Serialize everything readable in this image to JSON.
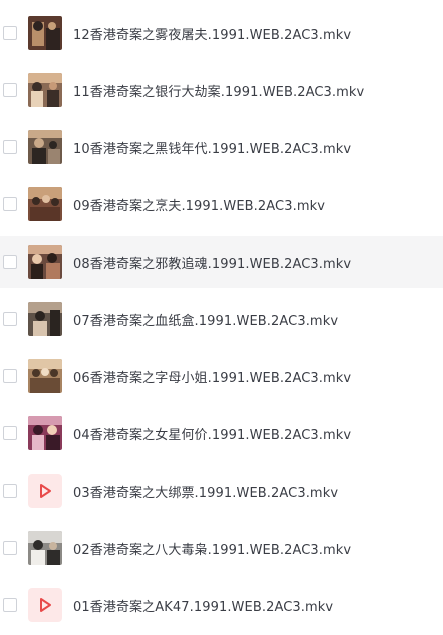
{
  "files": [
    {
      "name": "12香港奇案之雾夜屠夫.1991.WEB.2AC3.mkv",
      "thumb": "video-thumbnail",
      "colors": [
        "#5b3a2e",
        "#b98f6a",
        "#2e2320"
      ]
    },
    {
      "name": "11香港奇案之银行大劫案.1991.WEB.2AC3.mkv",
      "thumb": "video-thumbnail",
      "colors": [
        "#8a6a55",
        "#d6b28f",
        "#3b2e28"
      ]
    },
    {
      "name": "10香港奇案之黑钱年代.1991.WEB.2AC3.mkv",
      "thumb": "video-thumbnail",
      "colors": [
        "#6e5a4a",
        "#c9a989",
        "#2c2622"
      ]
    },
    {
      "name": "09香港奇案之烹夫.1991.WEB.2AC3.mkv",
      "thumb": "video-thumbnail",
      "colors": [
        "#7a4d3a",
        "#c9a07a",
        "#3a2a22"
      ]
    },
    {
      "name": "08香港奇案之邪教追魂.1991.WEB.2AC3.mkv",
      "thumb": "video-thumbnail",
      "colors": [
        "#6a4a3e",
        "#d2a98c",
        "#2b1f1a"
      ]
    },
    {
      "name": "07香港奇案之血纸盒.1991.WEB.2AC3.mkv",
      "thumb": "video-thumbnail",
      "colors": [
        "#5e5248",
        "#b4a08c",
        "#2a2420"
      ]
    },
    {
      "name": "06香港奇案之字母小姐.1991.WEB.2AC3.mkv",
      "thumb": "video-thumbnail",
      "colors": [
        "#a88462",
        "#e0c6a6",
        "#4a3628"
      ]
    },
    {
      "name": "04香港奇案之女星何价.1991.WEB.2AC3.mkv",
      "thumb": "video-thumbnail",
      "colors": [
        "#8a3a5a",
        "#d69ab0",
        "#3a1a28"
      ]
    },
    {
      "name": "03香港奇案之大绑票.1991.WEB.2AC3.mkv",
      "thumb": "video-icon",
      "colors": [
        "#fde8e8",
        "#e84a4a",
        "#ffffff"
      ]
    },
    {
      "name": "02香港奇案之八大毒枭.1991.WEB.2AC3.mkv",
      "thumb": "video-thumbnail",
      "colors": [
        "#8c8a86",
        "#d8d6d2",
        "#2e2c2a"
      ]
    },
    {
      "name": "01香港奇案之AK47.1991.WEB.2AC3.mkv",
      "thumb": "video-icon",
      "colors": [
        "#fde8e8",
        "#e84a4a",
        "#ffffff"
      ]
    }
  ],
  "hovered_index": 4
}
